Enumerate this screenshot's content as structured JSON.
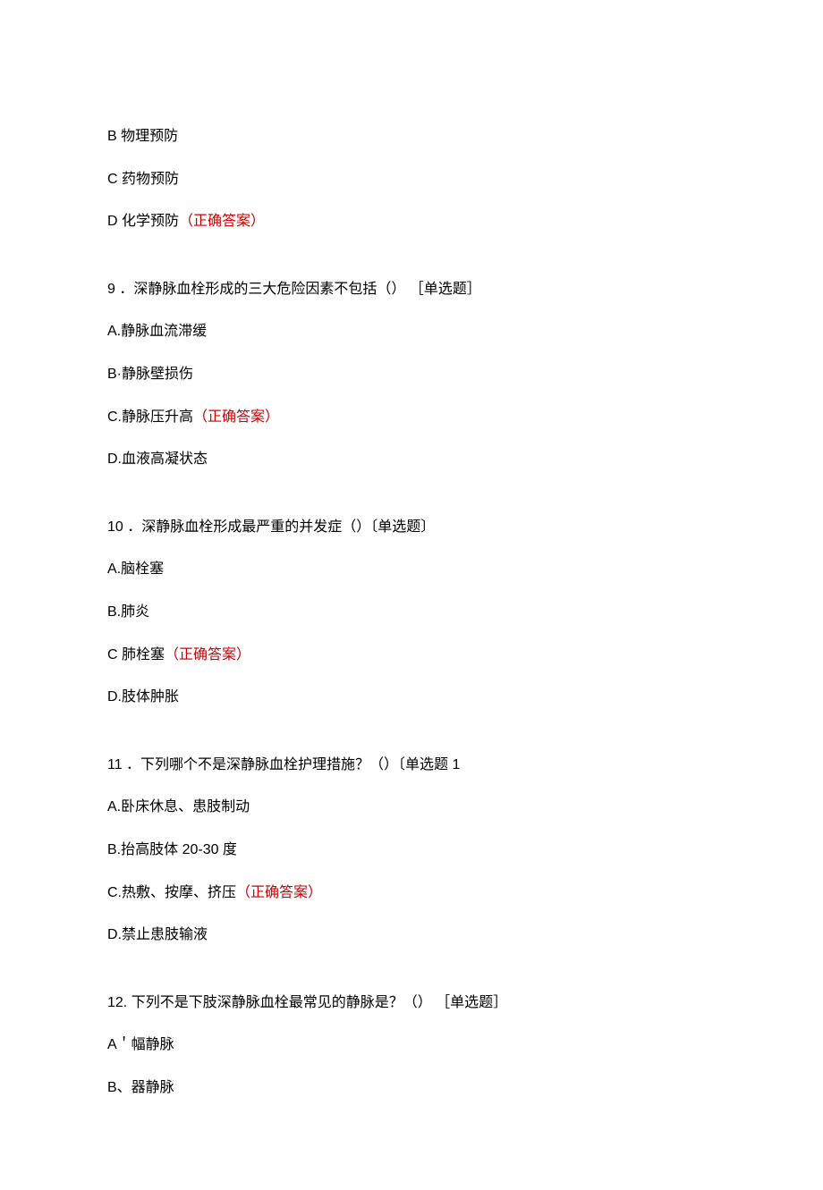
{
  "items": [
    {
      "text": "B 物理预防",
      "correct": false,
      "questionStart": false
    },
    {
      "text": "C 药物预防",
      "correct": false,
      "questionStart": false
    },
    {
      "text": "D 化学预防",
      "correct": true,
      "questionStart": false
    },
    {
      "text": "9 ．深静脉血栓形成的三大危险因素不包括（） ［单选题］",
      "correct": false,
      "questionStart": true
    },
    {
      "text": "A.静脉血流滞缓",
      "correct": false,
      "questionStart": false
    },
    {
      "text": "B·静脉壁损伤",
      "correct": false,
      "questionStart": false
    },
    {
      "text": "C.静脉压升高",
      "correct": true,
      "questionStart": false
    },
    {
      "text": "D.血液高凝状态",
      "correct": false,
      "questionStart": false
    },
    {
      "text": "10 ．深静脉血栓形成最严重的并发症（）〔单选题〕",
      "correct": false,
      "questionStart": true
    },
    {
      "text": "A.脑栓塞",
      "correct": false,
      "questionStart": false
    },
    {
      "text": "B.肺炎",
      "correct": false,
      "questionStart": false
    },
    {
      "text": "C 肺栓塞",
      "correct": true,
      "questionStart": false
    },
    {
      "text": "D.肢体肿胀",
      "correct": false,
      "questionStart": false
    },
    {
      "text": "11 ．下列哪个不是深静脉血栓护理措施？（）〔单选题 1",
      "correct": false,
      "questionStart": true
    },
    {
      "text": "A.卧床休息、患肢制动",
      "correct": false,
      "questionStart": false
    },
    {
      "text": "B.抬高肢体 20-30 度",
      "correct": false,
      "questionStart": false
    },
    {
      "text": "C.热敷、按摩、挤压",
      "correct": true,
      "questionStart": false
    },
    {
      "text": "D.禁止患肢输液",
      "correct": false,
      "questionStart": false
    },
    {
      "text": "12. 下列不是下肢深静脉血栓最常见的静脉是？（） ［单选题］",
      "correct": false,
      "questionStart": true
    },
    {
      "text": "A＇幅静脉",
      "correct": false,
      "questionStart": false
    },
    {
      "text": "B、器静脉",
      "correct": false,
      "questionStart": false
    }
  ],
  "correctLabel": "（正确答案）"
}
